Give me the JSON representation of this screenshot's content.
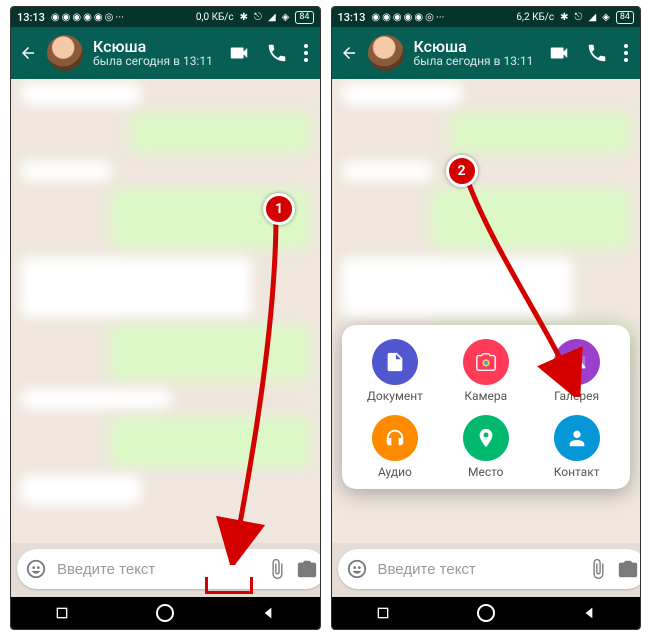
{
  "statusbar": {
    "time": "13:13",
    "net_left": "0,0 КБ/с",
    "net_right": "6,2 КБ/с",
    "battery": "84"
  },
  "header": {
    "contact_name": "Ксюша",
    "last_seen": "была сегодня в 13:11"
  },
  "composer": {
    "placeholder": "Введите текст"
  },
  "attach": {
    "document": "Документ",
    "camera": "Камера",
    "gallery": "Галерея",
    "audio": "Аудио",
    "location": "Место",
    "contact": "Контакт"
  },
  "annotations": {
    "step1": "1",
    "step2": "2"
  }
}
